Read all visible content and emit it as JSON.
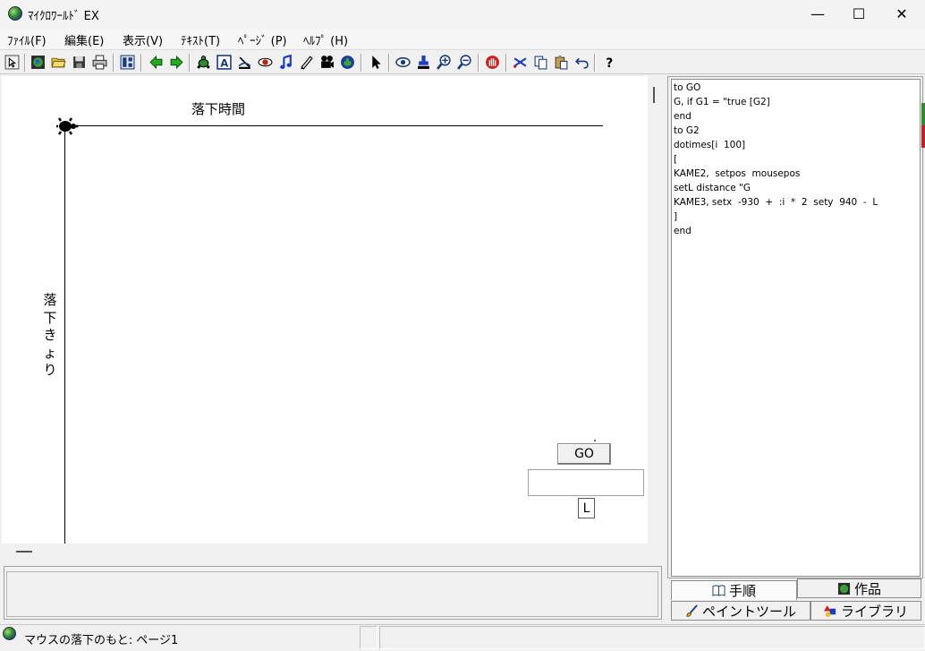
{
  "window": {
    "title": "ﾏｲｸﾛﾜｰﾙﾄﾞ EX",
    "minimize": "—",
    "maximize": "☐",
    "close": "✕"
  },
  "menu": [
    {
      "label": "ﾌｧｲﾙ(F)"
    },
    {
      "label": "編集(E)"
    },
    {
      "label": "表示(V)"
    },
    {
      "label": "ﾃｷｽﾄ(T)"
    },
    {
      "label": "ﾍﾟｰｼﾞ (P)"
    },
    {
      "label": "ﾍﾙﾌﾟ (H)"
    }
  ],
  "toolbar": {
    "icons": [
      "pointer-small-icon",
      "world-icon",
      "open-folder-icon",
      "save-disk-icon",
      "print-icon",
      "page-layout-icon",
      "arrow-left-icon",
      "arrow-right-icon",
      "turtle-icon",
      "text-box-icon",
      "satellite-icon",
      "eye-shape-icon",
      "music-note-icon",
      "pen-icon",
      "movie-camera-icon",
      "globe-turtle-icon",
      "select-arrow-icon",
      "eye-icon",
      "stamp-icon",
      "zoom-in-icon",
      "zoom-out-icon",
      "stop-hand-icon",
      "cut-icon",
      "copy-icon",
      "paste-icon",
      "undo-icon",
      "help-icon"
    ]
  },
  "canvas": {
    "x_axis_title": "落下時間",
    "y_axis_title": [
      "落",
      "下",
      "き",
      "ょ",
      "り"
    ],
    "go_button": "GO",
    "l_label": "L",
    "l_value": ""
  },
  "code": {
    "lines": [
      "to GO",
      "G, if G1 = \"true [G2]",
      "end",
      "to G2",
      "dotimes[i  100]",
      "[",
      "KAME2,  setpos  mousepos",
      "setL distance \"G",
      "KAME3, setx  -930  +  :i  *  2  sety  940  -  L",
      "]",
      "end"
    ]
  },
  "tabs": {
    "procedure": "手順",
    "works": "作品",
    "paint": "ペイントツール",
    "library": "ライブラリ"
  },
  "status": {
    "text": "マウスの落下のもと:  ページ1"
  }
}
